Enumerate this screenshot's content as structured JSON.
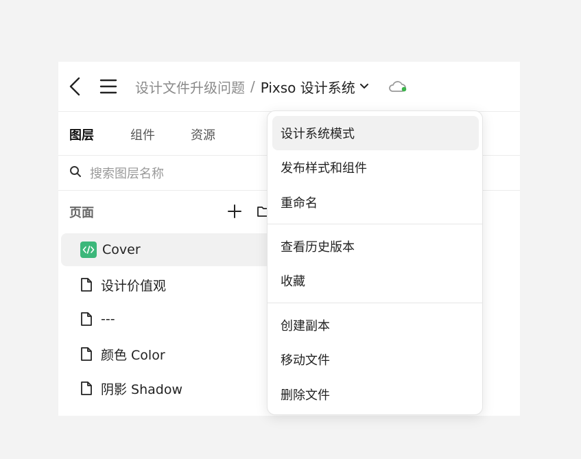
{
  "header": {
    "back_icon": "chevron-left-icon",
    "menu_icon": "hamburger-menu-icon",
    "breadcrumb_parent": "设计文件升级问题",
    "breadcrumb_separator": "/",
    "breadcrumb_current": "Pixso 设计系统",
    "cloud_icon": "cloud-sync-icon",
    "status_color": "#3cb44b"
  },
  "tabs": [
    {
      "label": "图层",
      "active": true
    },
    {
      "label": "组件",
      "active": false
    },
    {
      "label": "资源",
      "active": false
    }
  ],
  "search": {
    "placeholder": "搜索图层名称",
    "value": ""
  },
  "pages": {
    "title": "页面",
    "items": [
      {
        "label": "Cover",
        "icon": "code-icon",
        "selected": true
      },
      {
        "label": "设计价值观",
        "icon": "page-icon",
        "selected": false
      },
      {
        "label": "---",
        "icon": "page-icon",
        "selected": false
      },
      {
        "label": "颜色 Color",
        "icon": "page-icon",
        "selected": false
      },
      {
        "label": "阴影 Shadow",
        "icon": "page-icon",
        "selected": false
      }
    ]
  },
  "dropdown": {
    "groups": [
      [
        "设计系统模式",
        "发布样式和组件",
        "重命名"
      ],
      [
        "查看历史版本",
        "收藏"
      ],
      [
        "创建副本",
        "移动文件",
        "删除文件"
      ]
    ],
    "highlighted": "设计系统模式"
  },
  "colors": {
    "accent_green": "#3cb77a",
    "selected_bg": "#f1f1f1"
  }
}
